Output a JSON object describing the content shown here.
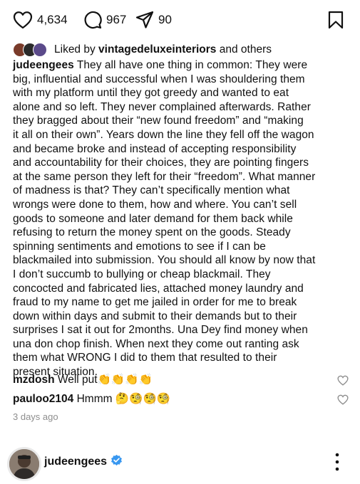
{
  "actions": {
    "likes_count": "4,634",
    "comments_count": "967",
    "shares_count": "90"
  },
  "likes": {
    "prefix": "Liked by",
    "user": "vintagedeluxeinteriors",
    "suffix": "and others"
  },
  "caption": {
    "username": "judeengees",
    "lines": [
      "They all have one thing in common: They were",
      "big, influential and successful when I was shouldering them",
      "with my platform until they got greedy and wanted to eat",
      "alone and so left. They never complained afterwards. Rather",
      "they bragged about their “new found freedom” and “making",
      "it all on their own”. Years down the line they fell off the wagon",
      "and became broke and instead of accepting responsibility",
      "and accountability for their choices, they are pointing fingers",
      "at the same person they left for their “freedom”. What manner",
      "of madness is that? They can’t specifically mention what",
      "wrongs were done to them, how and where. You can’t sell",
      "goods to someone and later demand for them back while",
      "refusing to return the money spent on the goods. Steady",
      "spinning sentiments and emotions to see if I can be",
      "blackmailed into submission. You should all know by now that",
      "I don’t succumb to bullying or cheap blackmail. They",
      "concocted and fabricated lies, attached money laundry  and",
      "fraud to my name to get me jailed in order for me to break",
      "down within days and submit to their demands but to their",
      "surprises I sat it out for 2months. Una Dey find money when",
      "una don chop finish. When next they come out ranting ask",
      "them what WRONG I did to them that resulted to their",
      "present situation."
    ]
  },
  "comments": [
    {
      "username": "mzdosh",
      "text": "Well put",
      "emoji": "👏👏👏👏"
    },
    {
      "username": "pauloo2104",
      "text": "Hmmm",
      "emoji": "🤔🧐🧐🧐"
    }
  ],
  "timestamp": "3 days ago",
  "profile": {
    "username": "judeengees",
    "verified_color": "#3897f0"
  },
  "icons": [
    "heart-icon",
    "comment-icon",
    "share-icon",
    "bookmark-icon",
    "verified-badge-icon",
    "more-options-icon"
  ]
}
